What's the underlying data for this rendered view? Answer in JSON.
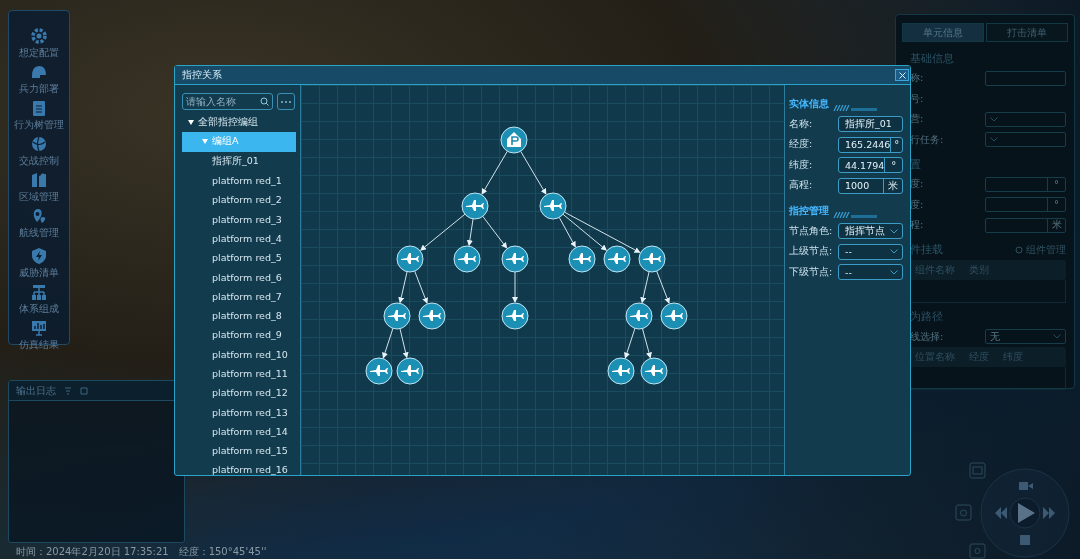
{
  "sidebar": {
    "groups": [
      [
        {
          "label": "想定配置"
        },
        {
          "label": "兵力部署"
        },
        {
          "label": "行为树管理"
        },
        {
          "label": "交战控制"
        },
        {
          "label": "区域管理"
        },
        {
          "label": "航线管理"
        }
      ],
      [
        {
          "label": "威胁清单"
        },
        {
          "label": "体系组成"
        },
        {
          "label": "仿真结果"
        }
      ]
    ]
  },
  "log_panel": {
    "title": "输出日志"
  },
  "status_bar": {
    "time": "时间：2024年2月20日 17:35:21",
    "longitude": "经度：150°45'45''"
  },
  "unit_panel": {
    "tabs": [
      {
        "label": "单元信息",
        "selected": true
      },
      {
        "label": "打击清单",
        "selected": false
      }
    ],
    "sections": [
      {
        "title": "基础信息",
        "rows": [
          {
            "kind": "input",
            "label": "称:"
          },
          {
            "kind": "text",
            "label": "号:"
          },
          {
            "kind": "select",
            "label": "营:"
          },
          {
            "kind": "select",
            "label": "行任务:"
          }
        ]
      },
      {
        "title": "置",
        "rows": [
          {
            "kind": "unit",
            "label": "度:",
            "unit": "°"
          },
          {
            "kind": "unit",
            "label": "度:",
            "unit": "°"
          },
          {
            "kind": "unit",
            "label": "程:",
            "unit": "米"
          }
        ]
      },
      {
        "title": "件挂载",
        "link": "组件管理",
        "columns": [
          "组件名称",
          "类别"
        ]
      },
      {
        "title": "为路径",
        "rows": [
          {
            "kind": "select",
            "label": "线选择:",
            "value": "无"
          }
        ],
        "columns": [
          "位置名称",
          "经度",
          "纬度"
        ]
      }
    ]
  },
  "dialog": {
    "title": "指控关系",
    "search": {
      "placeholder": "请输入名称"
    },
    "tree": [
      {
        "label": "全部指控编组",
        "expanded": true,
        "selected": false,
        "children": [
          {
            "label": "编组A",
            "expanded": true,
            "selected": true,
            "children": [
              {
                "label": "指挥所_01",
                "selected": false
              },
              {
                "label": "platform red_1",
                "selected": false
              },
              {
                "label": "platform red_2",
                "selected": false
              },
              {
                "label": "platform red_3",
                "selected": false
              },
              {
                "label": "platform red_4",
                "selected": false
              },
              {
                "label": "platform red_5",
                "selected": false
              },
              {
                "label": "platform red_6",
                "selected": false
              },
              {
                "label": "platform red_7",
                "selected": false
              },
              {
                "label": "platform red_8",
                "selected": false
              },
              {
                "label": "platform red_9",
                "selected": false
              },
              {
                "label": "platform red_10",
                "selected": false
              },
              {
                "label": "platform red_11",
                "selected": false
              },
              {
                "label": "platform red_12",
                "selected": false
              },
              {
                "label": "platform red_13",
                "selected": false
              },
              {
                "label": "platform red_14",
                "selected": false
              },
              {
                "label": "platform red_15",
                "selected": false
              },
              {
                "label": "platform red_16",
                "selected": false
              }
            ]
          }
        ]
      }
    ],
    "graph": {
      "kind": "command",
      "children": [
        {
          "kind": "aircraft",
          "children": [
            {
              "kind": "aircraft",
              "children": [
                {
                  "kind": "aircraft",
                  "children": [
                    {
                      "kind": "aircraft"
                    },
                    {
                      "kind": "aircraft"
                    }
                  ]
                },
                {
                  "kind": "aircraft"
                }
              ]
            },
            {
              "kind": "aircraft"
            },
            {
              "kind": "aircraft",
              "children": [
                {
                  "kind": "aircraft"
                }
              ]
            }
          ]
        },
        {
          "kind": "aircraft",
          "children": [
            {
              "kind": "aircraft"
            },
            {
              "kind": "aircraft"
            },
            {
              "kind": "aircraft",
              "children": [
                {
                  "kind": "aircraft",
                  "children": [
                    {
                      "kind": "aircraft"
                    },
                    {
                      "kind": "aircraft"
                    }
                  ]
                },
                {
                  "kind": "aircraft"
                }
              ]
            }
          ]
        }
      ]
    },
    "info_sections": [
      {
        "title": "实体信息",
        "rows": [
          {
            "kind": "plain",
            "label": "名称:",
            "value": "指挥所_01"
          },
          {
            "kind": "unit",
            "label": "经度:",
            "value": "165.2446",
            "unit": "°"
          },
          {
            "kind": "unit",
            "label": "纬度:",
            "value": "44.1794",
            "unit": "°"
          },
          {
            "kind": "unit",
            "label": "高程:",
            "value": "1000",
            "unit": "米"
          }
        ]
      },
      {
        "title": "指控管理",
        "rows": [
          {
            "kind": "select",
            "label": "节点角色:",
            "value": "指挥节点"
          },
          {
            "kind": "select",
            "label": "上级节点:",
            "value": "--"
          },
          {
            "kind": "select",
            "label": "下级节点:",
            "value": "--"
          }
        ]
      }
    ]
  }
}
